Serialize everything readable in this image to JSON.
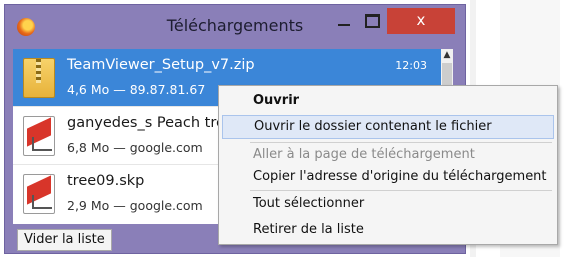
{
  "window": {
    "title": "Téléchargements",
    "close_label": "x"
  },
  "downloads": [
    {
      "name": "TeamViewer_Setup_v7.zip",
      "info": "4,6 Mo — 89.87.81.67",
      "time": "12:03",
      "icon": "zip-file-icon",
      "selected": true
    },
    {
      "name": "ganyedes_s Peach tre",
      "info": "6,8 Mo — google.com",
      "icon": "sketchup-file-icon",
      "selected": false
    },
    {
      "name": "tree09.skp",
      "info": "2,9 Mo — google.com",
      "icon": "sketchup-file-icon",
      "selected": false
    }
  ],
  "footer": {
    "clear_list_label": "Vider la liste"
  },
  "context_menu": {
    "open": "Ouvrir",
    "open_folder": "Ouvrir le dossier contenant le fichier",
    "go_to_page": "Aller à la page de téléchargement",
    "copy_address": "Copier l'adresse d'origine du téléchargement",
    "select_all": "Tout sélectionner",
    "remove_from_list": "Retirer de la liste"
  },
  "colors": {
    "window_frame": "#8a7fb8",
    "selection": "#3b86d8",
    "close_button": "#c84237"
  }
}
